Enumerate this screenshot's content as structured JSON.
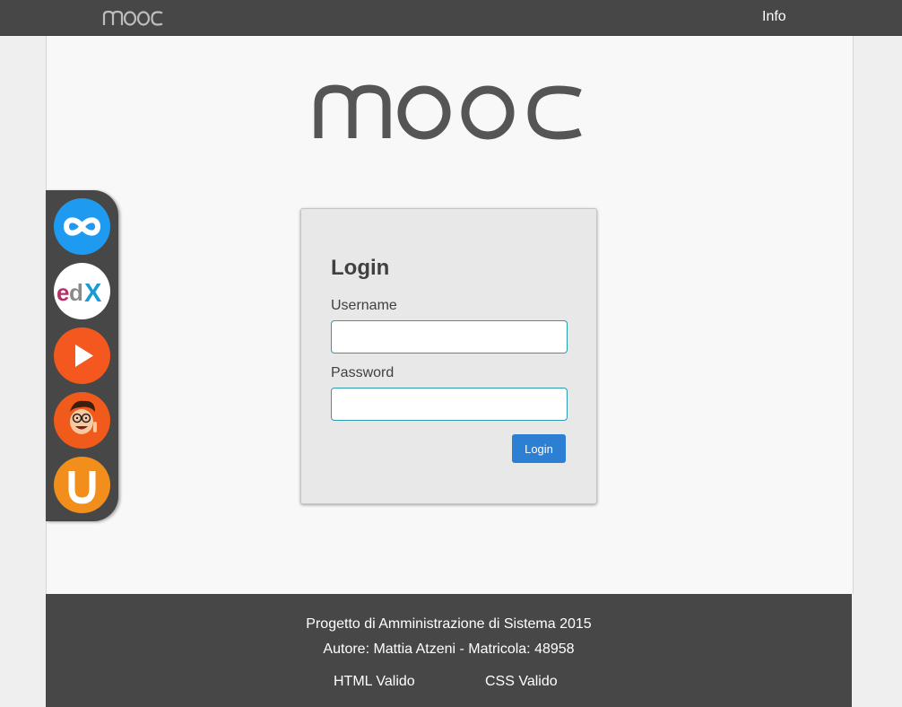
{
  "topbar": {
    "brand": "mooc",
    "info_label": "Info"
  },
  "logo": {
    "text": "mooc",
    "color": "#555555"
  },
  "dock": {
    "apps": [
      {
        "name": "coursera",
        "icon": "infinity-icon",
        "bg": "#1e9bf0"
      },
      {
        "name": "edx",
        "icon": "edx-icon",
        "bg": "#ffffff"
      },
      {
        "name": "play",
        "icon": "play-icon",
        "bg": "#f4581e"
      },
      {
        "name": "avatar",
        "icon": "cartoon-face-icon",
        "bg": "#f05a1a"
      },
      {
        "name": "udacity",
        "icon": "u-icon",
        "bg": "#f28f1c"
      }
    ]
  },
  "login": {
    "title": "Login",
    "username_label": "Username",
    "username_value": "",
    "password_label": "Password",
    "password_value": "",
    "button_label": "Login"
  },
  "footer": {
    "line1": "Progetto di Amministrazione di Sistema 2015",
    "line2": "Autore: Mattia Atzeni - Matricola: 48958",
    "html_link": "HTML Valido",
    "css_link": "CSS Valido"
  },
  "colors": {
    "bar": "#474747",
    "accent": "#2c7fd3",
    "input_border": "#2a9bb0"
  }
}
